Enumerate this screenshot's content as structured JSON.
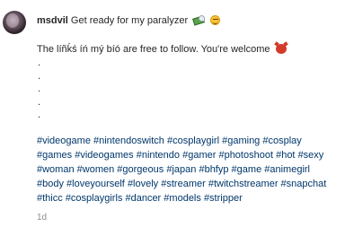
{
  "post": {
    "username": "msdvil",
    "caption_line1": "Get ready for my paralyzer",
    "caption_line2": "The líñḱś íń mý bíó are free to follow. You're welcome",
    "dots": [
      ".",
      ".",
      ".",
      ".",
      "."
    ],
    "hashtags": [
      "#videogame",
      "#nintendoswitch",
      "#cosplaygirl",
      "#gaming",
      "#cosplay",
      "#games",
      "#videogames",
      "#nintendo",
      "#gamer",
      "#photoshoot",
      "#hot",
      "#sexy",
      "#woman",
      "#women",
      "#gorgeous",
      "#japan",
      "#bhfyp",
      "#game",
      "#animegirl",
      "#body",
      "#loveyourself",
      "#lovely",
      "#streamer",
      "#twitchstreamer",
      "#snapchat",
      "#thicc",
      "#cosplaygirls",
      "#dancer",
      "#models",
      "#stripper"
    ],
    "timestamp": "1d",
    "icons": [
      "money-with-wings-icon",
      "smiling-face-icon",
      "devil-face-icon"
    ]
  }
}
